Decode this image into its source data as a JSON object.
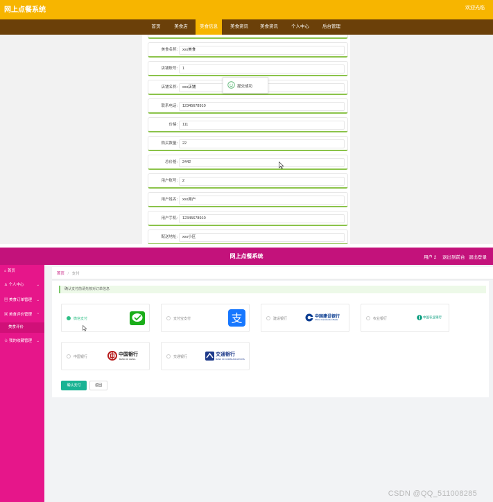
{
  "top": {
    "app_title": "网上点餐系统",
    "welcome": "欢迎光临",
    "nav": [
      {
        "label": "首页",
        "active": false
      },
      {
        "label": "美食店",
        "active": false
      },
      {
        "label": "美食信息",
        "active": true
      },
      {
        "label": "美食资讯",
        "active": false
      },
      {
        "label": "美食资讯",
        "active": false
      },
      {
        "label": "个人中心",
        "active": false
      },
      {
        "label": "后台管理",
        "active": false
      }
    ],
    "form": [
      {
        "label": "美食名称:",
        "value": "xxx美食"
      },
      {
        "label": "店铺账号:",
        "value": "1"
      },
      {
        "label": "店铺名称:",
        "value": "xxx店铺"
      },
      {
        "label": "联系电话:",
        "value": "12345678910"
      },
      {
        "label": "价格:",
        "value": "111"
      },
      {
        "label": "购买数量:",
        "value": "22"
      },
      {
        "label": "总价格:",
        "value": "2442"
      },
      {
        "label": "用户账号:",
        "value": "2"
      },
      {
        "label": "用户姓名:",
        "value": "xxx用户"
      },
      {
        "label": "用户手机:",
        "value": "12345678910"
      },
      {
        "label": "配送地址:",
        "value": "xxx小区"
      }
    ],
    "toast": "提交成功"
  },
  "bottom": {
    "app_title": "网上点餐系统",
    "header_right": [
      "用户 2",
      "退出到前台",
      "退出登录"
    ],
    "sidebar": [
      {
        "label": "首页",
        "icon": "home-icon",
        "has_arrow": false,
        "sub": false
      },
      {
        "label": "个人中心",
        "icon": "user-icon",
        "has_arrow": true,
        "sub": false
      },
      {
        "label": "美食订单管理",
        "icon": "list-icon",
        "has_arrow": true,
        "sub": false
      },
      {
        "label": "美食评价管理",
        "icon": "comment-icon",
        "has_arrow": true,
        "sub": false
      },
      {
        "label": "美食评价",
        "icon": "",
        "has_arrow": false,
        "sub": true
      },
      {
        "label": "我的收藏管理",
        "icon": "star-icon",
        "has_arrow": true,
        "sub": false
      }
    ],
    "breadcrumb": {
      "home": "首页",
      "sep": "/",
      "current": "支付"
    },
    "tip": "确认支付前请先核对订单信息",
    "payments": [
      {
        "label": "微信支付",
        "selected": true,
        "logo": "wechat-pay-logo"
      },
      {
        "label": "支付宝支付",
        "selected": false,
        "logo": "alipay-logo"
      },
      {
        "label": "建设银行",
        "selected": false,
        "logo": "ccb-logo"
      },
      {
        "label": "农业银行",
        "selected": false,
        "logo": "abc-logo"
      },
      {
        "label": "中国银行",
        "selected": false,
        "logo": "boc-logo"
      },
      {
        "label": "交通银行",
        "selected": false,
        "logo": "bocom-logo"
      }
    ],
    "logo_text": {
      "ccb": "中国建设银行",
      "ccb_en": "China Construction Bank",
      "abc": "中国农业银行",
      "boc": "中国银行",
      "boc_en": "BANK OF CHINA",
      "bocom": "交通银行",
      "bocom_en": "BANK OF COMMUNICATIONS"
    },
    "buttons": {
      "confirm": "确认支付",
      "back": "返回"
    },
    "watermark": "CSDN @QQ_511008285"
  },
  "colors": {
    "top_header": "#f7b500",
    "top_nav": "#6b4009",
    "form_accent": "#8bc34a",
    "bottom_header": "#c3127b",
    "sidebar": "#e6168a",
    "primary_button": "#1ab394"
  }
}
